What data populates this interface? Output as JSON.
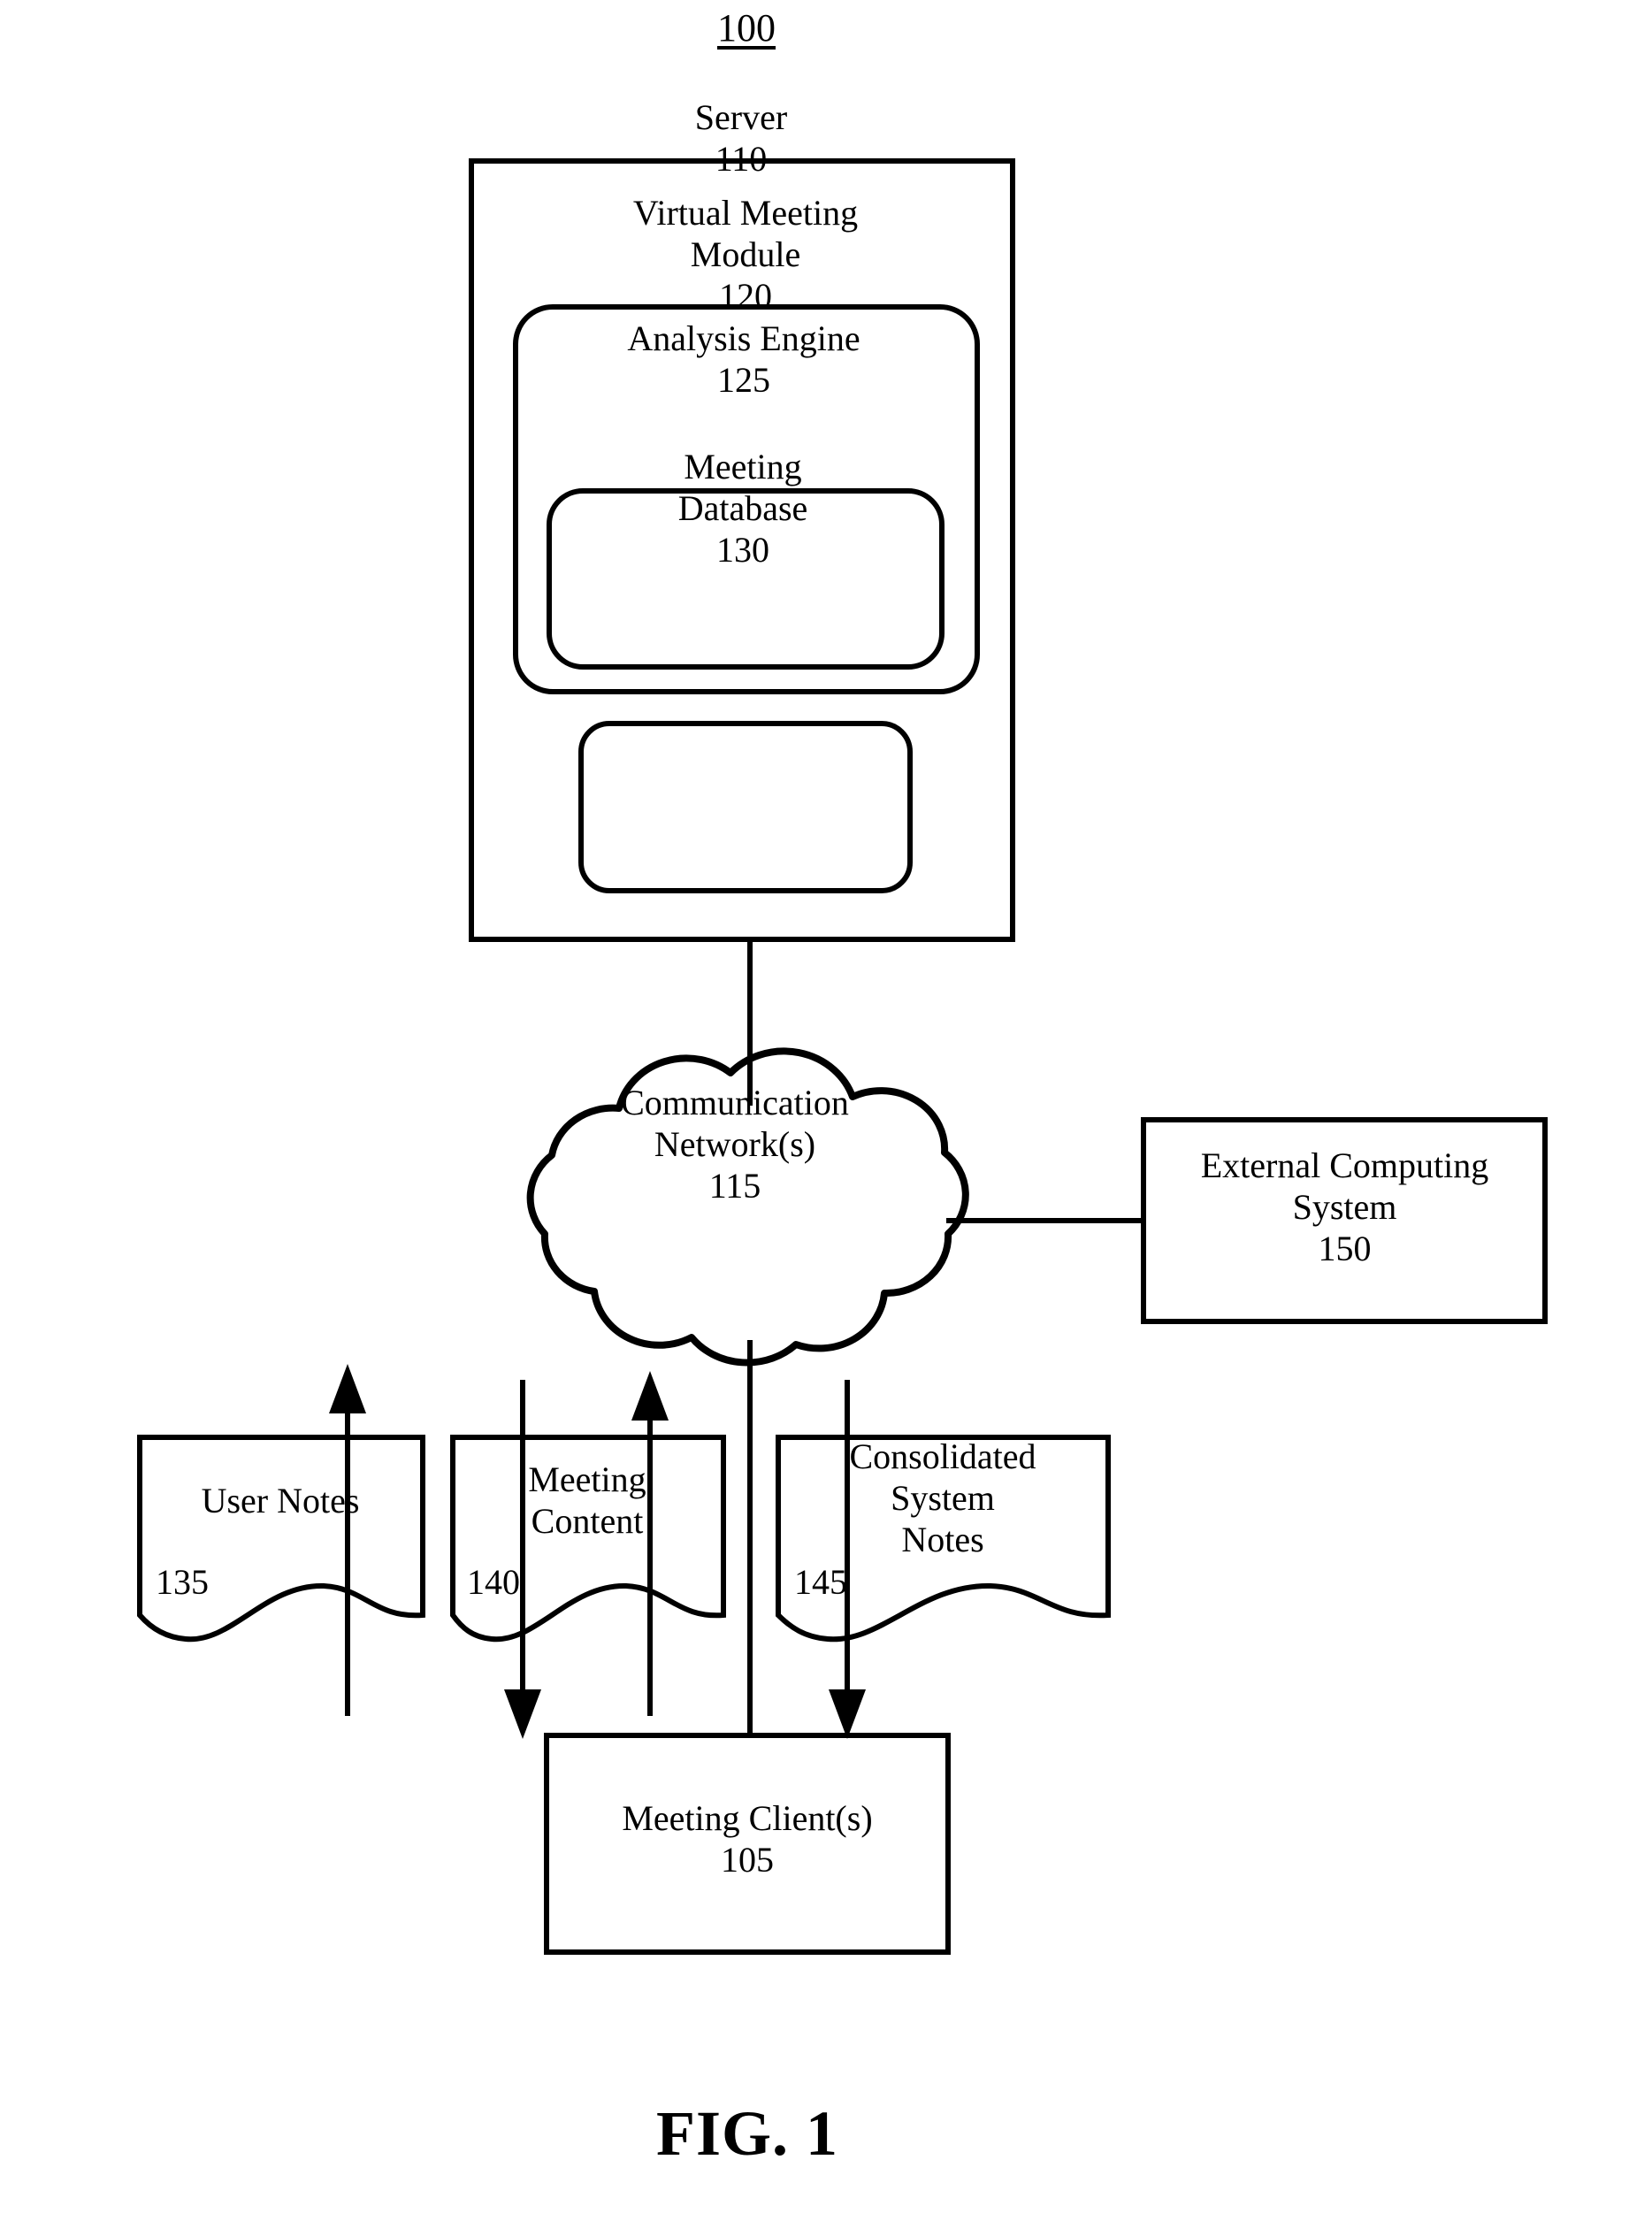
{
  "figure": {
    "reference_number": "100",
    "caption": "FIG. 1"
  },
  "nodes": {
    "server": {
      "title": "Server",
      "ref": "110",
      "text": "Server\n110",
      "shape": "rectangle"
    },
    "virtual_meeting_module": {
      "title": "Virtual Meeting Module",
      "ref": "120",
      "text": "Virtual Meeting\nModule\n120",
      "shape": "rounded-rectangle"
    },
    "analysis_engine": {
      "title": "Analysis Engine",
      "ref": "125",
      "text": "Analysis Engine\n125",
      "shape": "rounded-rectangle"
    },
    "meeting_database": {
      "title": "Meeting Database",
      "ref": "130",
      "text": "Meeting\nDatabase\n130",
      "shape": "rounded-rectangle"
    },
    "communication_network": {
      "title": "Communication Network(s)",
      "ref": "115",
      "text": "Communication\nNetwork(s)\n115",
      "shape": "cloud"
    },
    "external_computing_system": {
      "title": "External Computing System",
      "ref": "150",
      "text": "External Computing\nSystem\n150",
      "shape": "rectangle"
    },
    "user_notes": {
      "title": "User Notes",
      "ref": "135",
      "text": "User Notes",
      "shape": "document"
    },
    "meeting_content": {
      "title": "Meeting Content",
      "ref": "140",
      "text": "Meeting\nContent",
      "shape": "document"
    },
    "consolidated_system_notes": {
      "title": "Consolidated System Notes",
      "ref": "145",
      "text": "Consolidated\nSystem\nNotes",
      "shape": "document"
    },
    "meeting_clients": {
      "title": "Meeting Client(s)",
      "ref": "105",
      "text": "Meeting Client(s)\n105",
      "shape": "rectangle"
    }
  },
  "colors": {
    "stroke": "#000000",
    "background": "#ffffff"
  }
}
